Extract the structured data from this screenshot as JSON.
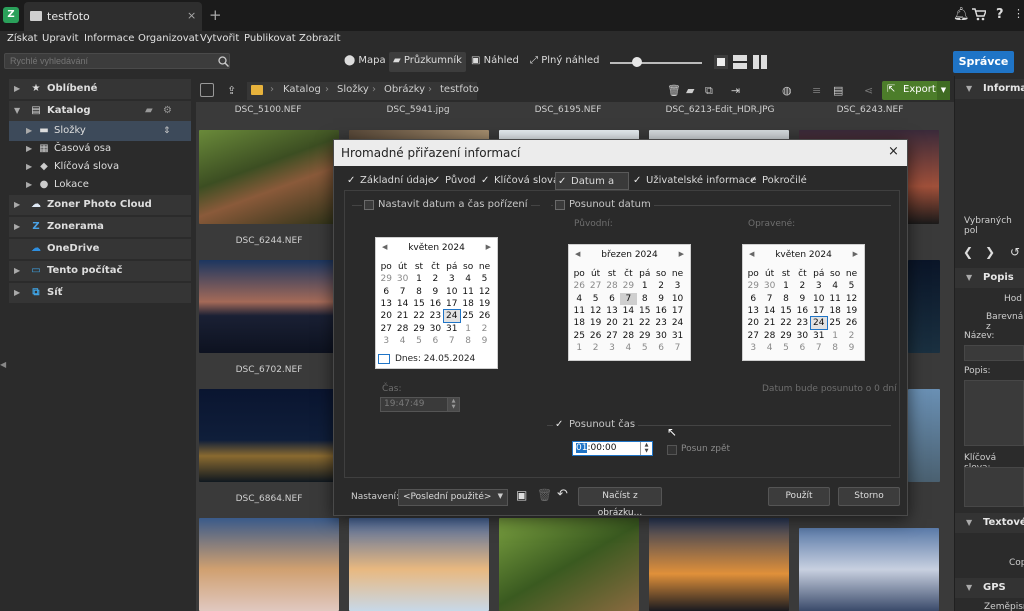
{
  "app": {
    "tab_title": "testfoto",
    "logo": "Z",
    "new_tab": "+",
    "close_tab": "×"
  },
  "menu": [
    "Získat",
    "Upravit",
    "Informace",
    "Organizovat",
    "Vytvořit",
    "Publikovat",
    "Zobrazit"
  ],
  "search": {
    "placeholder": "Rychlé vyhledávání"
  },
  "views": {
    "map": "Mapa",
    "explorer": "Průzkumník",
    "preview": "Náhled",
    "full": "Plný náhled"
  },
  "admin_button": "Správce",
  "zoom": {
    "level": 0.29
  },
  "sidebar": {
    "favorites": "Oblíbené",
    "catalog": "Katalog",
    "folders": "Složky",
    "timeline": "Časová osa",
    "keywords": "Klíčová slova",
    "locations": "Lokace",
    "cloud": "Zoner Photo Cloud",
    "zonerama": "Zonerama",
    "onedrive": "OneDrive",
    "this_pc": "Tento počítač",
    "network": "Síť"
  },
  "breadcrumb": [
    "Katalog",
    "Složky",
    "Obrázky",
    "testfoto"
  ],
  "export_label": "Export",
  "files_top": [
    "DSC_5100.NEF",
    "DSC_5941.jpg",
    "DSC_6195.NEF",
    "DSC_6213-Edit_HDR.JPG",
    "DSC_6243.NEF"
  ],
  "files_left": [
    "DSC_6244.NEF",
    "DSC_6702.NEF",
    "DSC_6864.NEF"
  ],
  "right_panel": {
    "info": "Informac",
    "selected": "Vybraných pol",
    "description": "Popis",
    "rating": "Hod",
    "color": "Barevná z",
    "title": "Název:",
    "desc": "Popis:",
    "keywords": "Klíčová slova:",
    "text": "Textové",
    "copy": "Cop",
    "gps": "GPS",
    "lat": "Zeměpisn"
  },
  "dialog": {
    "title": "Hromadné přiřazení informací",
    "close": "×",
    "tabs": [
      {
        "label": "Základní údaje",
        "checked": true
      },
      {
        "label": "Původ",
        "checked": true
      },
      {
        "label": "Klíčová slova",
        "checked": true
      },
      {
        "label": "Datum a čas",
        "checked": true
      },
      {
        "label": "Uživatelské informace",
        "checked": true
      },
      {
        "label": "Pokročilé",
        "checked": true
      }
    ],
    "set_datetime": "Nastavit datum a čas pořízení",
    "shift_date": "Posunout datum",
    "original": "Původní:",
    "corrected": "Opravené:",
    "time_label": "Čas:",
    "time_value": "19:47:49",
    "date_note": "Datum bude posunuto o 0 dní",
    "shift_time": "Posunout čas",
    "shift_value_sel": "01",
    "shift_value_rest": ":00:00",
    "shift_back": "Posun zpět",
    "settings_label": "Nastavení:",
    "preset": "<Poslední použité>",
    "load_from_image": "Načíst z obrázku...",
    "apply": "Použít",
    "cancel": "Storno",
    "weekdays": [
      "po",
      "út",
      "st",
      "čt",
      "pá",
      "so",
      "ne"
    ],
    "today_label": "Dnes: 24.05.2024",
    "cal1": {
      "header": "květen 2024",
      "weeks": [
        [
          "29",
          "30",
          "1",
          "2",
          "3",
          "4",
          "5"
        ],
        [
          "6",
          "7",
          "8",
          "9",
          "10",
          "11",
          "12"
        ],
        [
          "13",
          "14",
          "15",
          "16",
          "17",
          "18",
          "19"
        ],
        [
          "20",
          "21",
          "22",
          "23",
          "24",
          "25",
          "26"
        ],
        [
          "27",
          "28",
          "29",
          "30",
          "31",
          "1",
          "2"
        ],
        [
          "3",
          "4",
          "5",
          "6",
          "7",
          "8",
          "9"
        ]
      ]
    },
    "cal2": {
      "header": "březen 2024",
      "weeks": [
        [
          "26",
          "27",
          "28",
          "29",
          "1",
          "2",
          "3"
        ],
        [
          "4",
          "5",
          "6",
          "7",
          "8",
          "9",
          "10"
        ],
        [
          "11",
          "12",
          "13",
          "14",
          "15",
          "16",
          "17"
        ],
        [
          "18",
          "19",
          "20",
          "21",
          "22",
          "23",
          "24"
        ],
        [
          "25",
          "26",
          "27",
          "28",
          "29",
          "30",
          "31"
        ],
        [
          "1",
          "2",
          "3",
          "4",
          "5",
          "6",
          "7"
        ]
      ]
    },
    "cal3": {
      "header": "květen 2024",
      "weeks": [
        [
          "29",
          "30",
          "1",
          "2",
          "3",
          "4",
          "5"
        ],
        [
          "6",
          "7",
          "8",
          "9",
          "10",
          "11",
          "12"
        ],
        [
          "13",
          "14",
          "15",
          "16",
          "17",
          "18",
          "19"
        ],
        [
          "20",
          "21",
          "22",
          "23",
          "24",
          "25",
          "26"
        ],
        [
          "27",
          "28",
          "29",
          "30",
          "31",
          "1",
          "2"
        ],
        [
          "3",
          "4",
          "5",
          "6",
          "7",
          "8",
          "9"
        ]
      ]
    }
  }
}
